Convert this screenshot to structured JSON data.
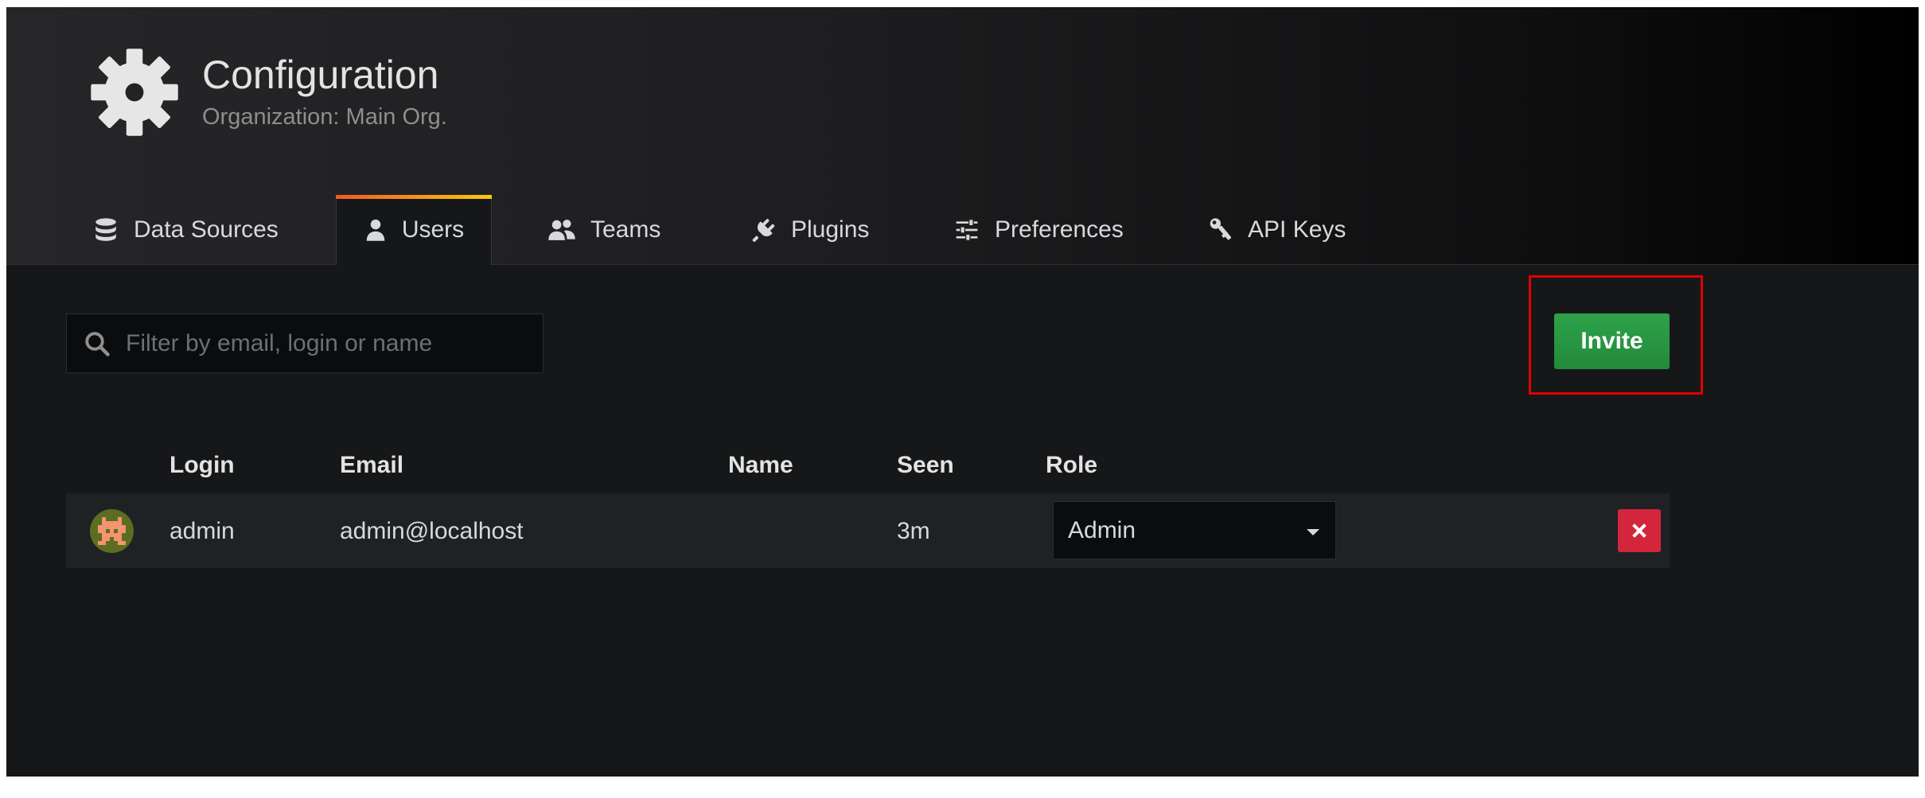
{
  "header": {
    "title": "Configuration",
    "subtitle": "Organization: Main Org.",
    "icon": "gear-icon"
  },
  "tabs": [
    {
      "label": "Data Sources",
      "icon": "database-icon",
      "active": false
    },
    {
      "label": "Users",
      "icon": "user-icon",
      "active": true
    },
    {
      "label": "Teams",
      "icon": "users-icon",
      "active": false
    },
    {
      "label": "Plugins",
      "icon": "plug-icon",
      "active": false
    },
    {
      "label": "Preferences",
      "icon": "sliders-icon",
      "active": false
    },
    {
      "label": "API Keys",
      "icon": "key-icon",
      "active": false
    }
  ],
  "search": {
    "placeholder": "Filter by email, login or name",
    "value": ""
  },
  "actions": {
    "invite_label": "Invite"
  },
  "table": {
    "columns": [
      "Login",
      "Email",
      "Name",
      "Seen",
      "Role"
    ],
    "rows": [
      {
        "login": "admin",
        "email": "admin@localhost",
        "name": "",
        "seen": "3m",
        "role": "Admin"
      }
    ]
  },
  "colors": {
    "background": "#161719",
    "invite_green": "#299c46",
    "delete_red": "#d3263c",
    "highlight_red": "#e00000",
    "tab_accent_start": "#f05a28",
    "tab_accent_end": "#fbca0a"
  }
}
